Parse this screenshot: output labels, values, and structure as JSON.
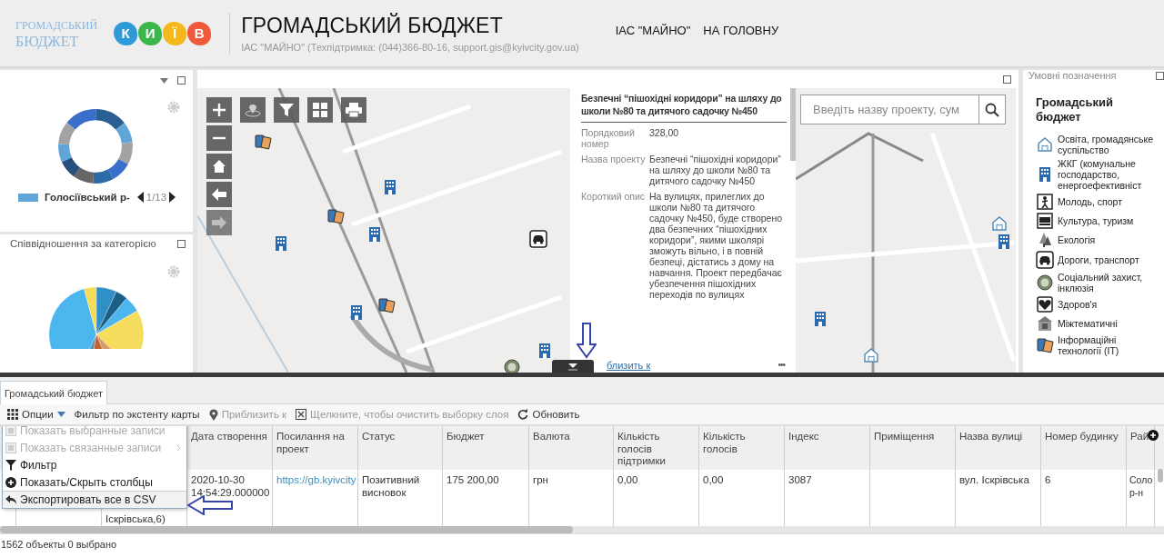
{
  "header": {
    "brand_lines": [
      "ГРОМАДСЬКИЙ",
      "БЮДЖЕТ"
    ],
    "logo_letters": [
      {
        "letter": "К",
        "color": "#2f9ad8"
      },
      {
        "letter": "И",
        "color": "#3cb54a"
      },
      {
        "letter": "Ї",
        "color": "#f4b81c"
      },
      {
        "letter": "В",
        "color": "#ef5a3c"
      }
    ],
    "title": "ГРОМАДСЬКИЙ БЮДЖЕТ",
    "subtitle": "ІАС \"МАЙНО\" (Техпідтримка: (044)366-80-16, support.gis@kyivcity.gov.ua)",
    "nav": [
      "ІАС \"МАЙНО\"",
      "НА ГОЛОВНУ"
    ]
  },
  "district_widget": {
    "legend_label": "Голосіївський р-",
    "page": "1/13"
  },
  "category_widget": {
    "title": "Співвідношення за категорією"
  },
  "popup": {
    "title": "Безпечні “пішохідні коридори” на шляху до школи №80 та дитячого садочку №450",
    "fields": [
      {
        "label": "Порядковий номер",
        "value": "328,00"
      },
      {
        "label": "Назва проекту",
        "value": "Безпечні “пішохідні коридори” на шляху до школи №80 та дитячого садочку №450"
      },
      {
        "label": "Короткий опис",
        "value": "На вулицях, прилеглих до школи №80 та дитячого садочку №450, буде створено два безпечних “пішохідних коридори”, якими школярі зможуть вільно, і в повній безпеці, дістатись з дому на навчання. Проект передбачає убезпечення пішохідних переходів по вулицях"
      }
    ],
    "link": "близить к",
    "more": "•••"
  },
  "search": {
    "placeholder": "Введіть назву проекту, сум"
  },
  "legend": {
    "panel_title": "Умовні позначення",
    "title": "Громадський бюджет",
    "items": [
      {
        "kind": "education",
        "label": "Освіта, громадянське суспільство"
      },
      {
        "kind": "housing",
        "label": "ЖКГ (комунальне господарство, енергоефективніст"
      },
      {
        "kind": "sport",
        "label": "Молодь, спорт"
      },
      {
        "kind": "culture",
        "label": "Культура, туризм"
      },
      {
        "kind": "ecology",
        "label": "Екологія"
      },
      {
        "kind": "roads",
        "label": "Дороги, транспорт"
      },
      {
        "kind": "social",
        "label": "Соціальний захист, інклюзія"
      },
      {
        "kind": "health",
        "label": "Здоров'я"
      },
      {
        "kind": "misc",
        "label": "Міжтематичні"
      },
      {
        "kind": "it",
        "label": "Інформаційні технології (IT)"
      }
    ]
  },
  "table_tab": {
    "label": "Громадський бюджет",
    "selected": true
  },
  "toolbar": [
    {
      "kind": "options",
      "label": "Опции",
      "disabled": false
    },
    {
      "kind": "extent",
      "label": "Фильтр по экстенту карты",
      "disabled": false
    },
    {
      "kind": "zoom",
      "label": "Приблизить к",
      "disabled": true
    },
    {
      "kind": "clear",
      "label": "Щелкните, чтобы очистить выборку слоя",
      "disabled": true
    },
    {
      "kind": "refresh",
      "label": "Обновить",
      "disabled": false
    }
  ],
  "options_menu": [
    {
      "kind": "selected",
      "label": "Показать выбранные записи",
      "disabled": true
    },
    {
      "kind": "related",
      "label": "Показать связанные записи",
      "disabled": true
    },
    {
      "kind": "filter",
      "label": "Фильтр",
      "disabled": false
    },
    {
      "kind": "columns",
      "label": "Показать/Скрыть столбцы",
      "disabled": false
    },
    {
      "kind": "export",
      "label": "Экспортировать все в CSV",
      "disabled": false
    }
  ],
  "table": {
    "columns": [
      "Дата створення",
      "Посилання на проект",
      "Статус",
      "Бюджет",
      "Валюта",
      "Кількість голосів підтримки",
      "Кількість голосів",
      "Індекс",
      "Приміщення",
      "Назва вулиці",
      "Номер будинку",
      "Рай"
    ],
    "rows": [
      {
        "column_3": "Іскрівська,6)",
        "cells": [
          "2020-10-30 14:54:29.000000",
          "https://gb.kyivcity",
          "Позитивний висновок",
          "175 200,00",
          "грн",
          "0,00",
          "0,00",
          "3087",
          "",
          "вул. Іскрівська",
          "6",
          "Соло р-н"
        ]
      }
    ]
  },
  "status_bar": "1562 объекты 0 выбрано"
}
